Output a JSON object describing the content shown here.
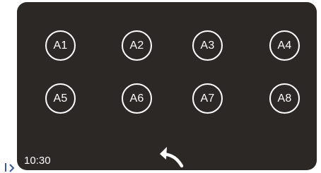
{
  "buttons": [
    {
      "label": "A1"
    },
    {
      "label": "A2"
    },
    {
      "label": "A3"
    },
    {
      "label": "A4"
    },
    {
      "label": "A5"
    },
    {
      "label": "A6"
    },
    {
      "label": "A7"
    },
    {
      "label": "A8"
    }
  ],
  "status": {
    "time": "10:30"
  },
  "icons": {
    "back": "back-arrow-icon"
  },
  "colors": {
    "panel_bg": "#2b2825",
    "foreground": "#ffffff"
  }
}
